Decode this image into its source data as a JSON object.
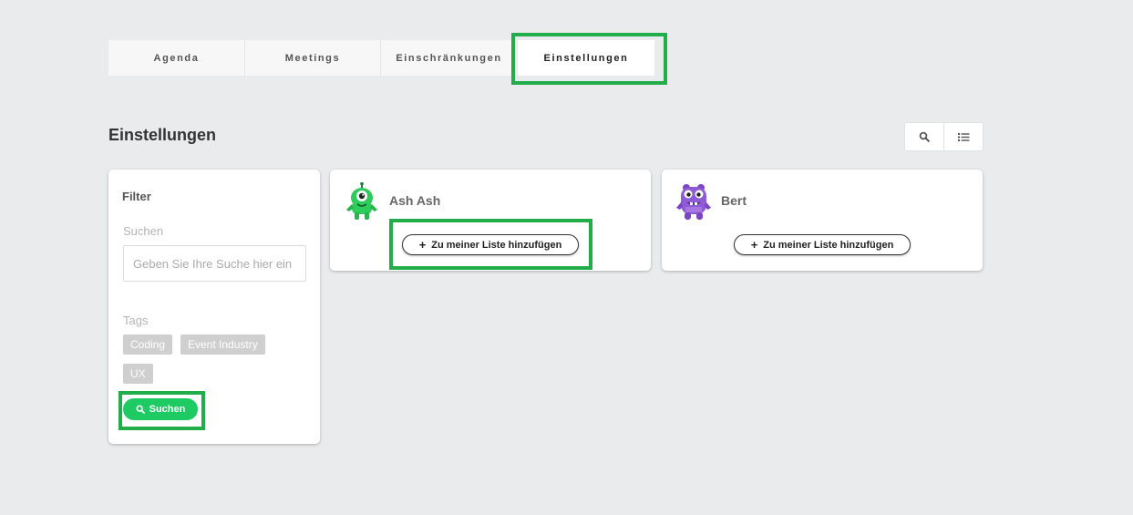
{
  "tabs": [
    {
      "label": "Agenda"
    },
    {
      "label": "Meetings"
    },
    {
      "label": "Einschränkungen"
    },
    {
      "label": "Einstellungen"
    }
  ],
  "page": {
    "title": "Einstellungen"
  },
  "view_toggle": {
    "icons": [
      "search-icon",
      "list-icon"
    ]
  },
  "filter": {
    "title": "Filter",
    "search_label": "Suchen",
    "search_placeholder": "Geben Sie Ihre Suche hier ein",
    "tags_label": "Tags",
    "tags": [
      "Coding",
      "Event Industry",
      "UX"
    ],
    "search_button": "Suchen"
  },
  "people": [
    {
      "name": "Ash Ash",
      "add_label": "Zu meiner Liste hinzufügen",
      "avatar_color": "#2ecc5a"
    },
    {
      "name": "Bert",
      "add_label": "Zu meiner Liste hinzufügen",
      "avatar_color": "#8e5ad6"
    }
  ],
  "colors": {
    "background": "#e9ebec",
    "highlight": "#21ad4a",
    "accent": "#1ecb63"
  }
}
